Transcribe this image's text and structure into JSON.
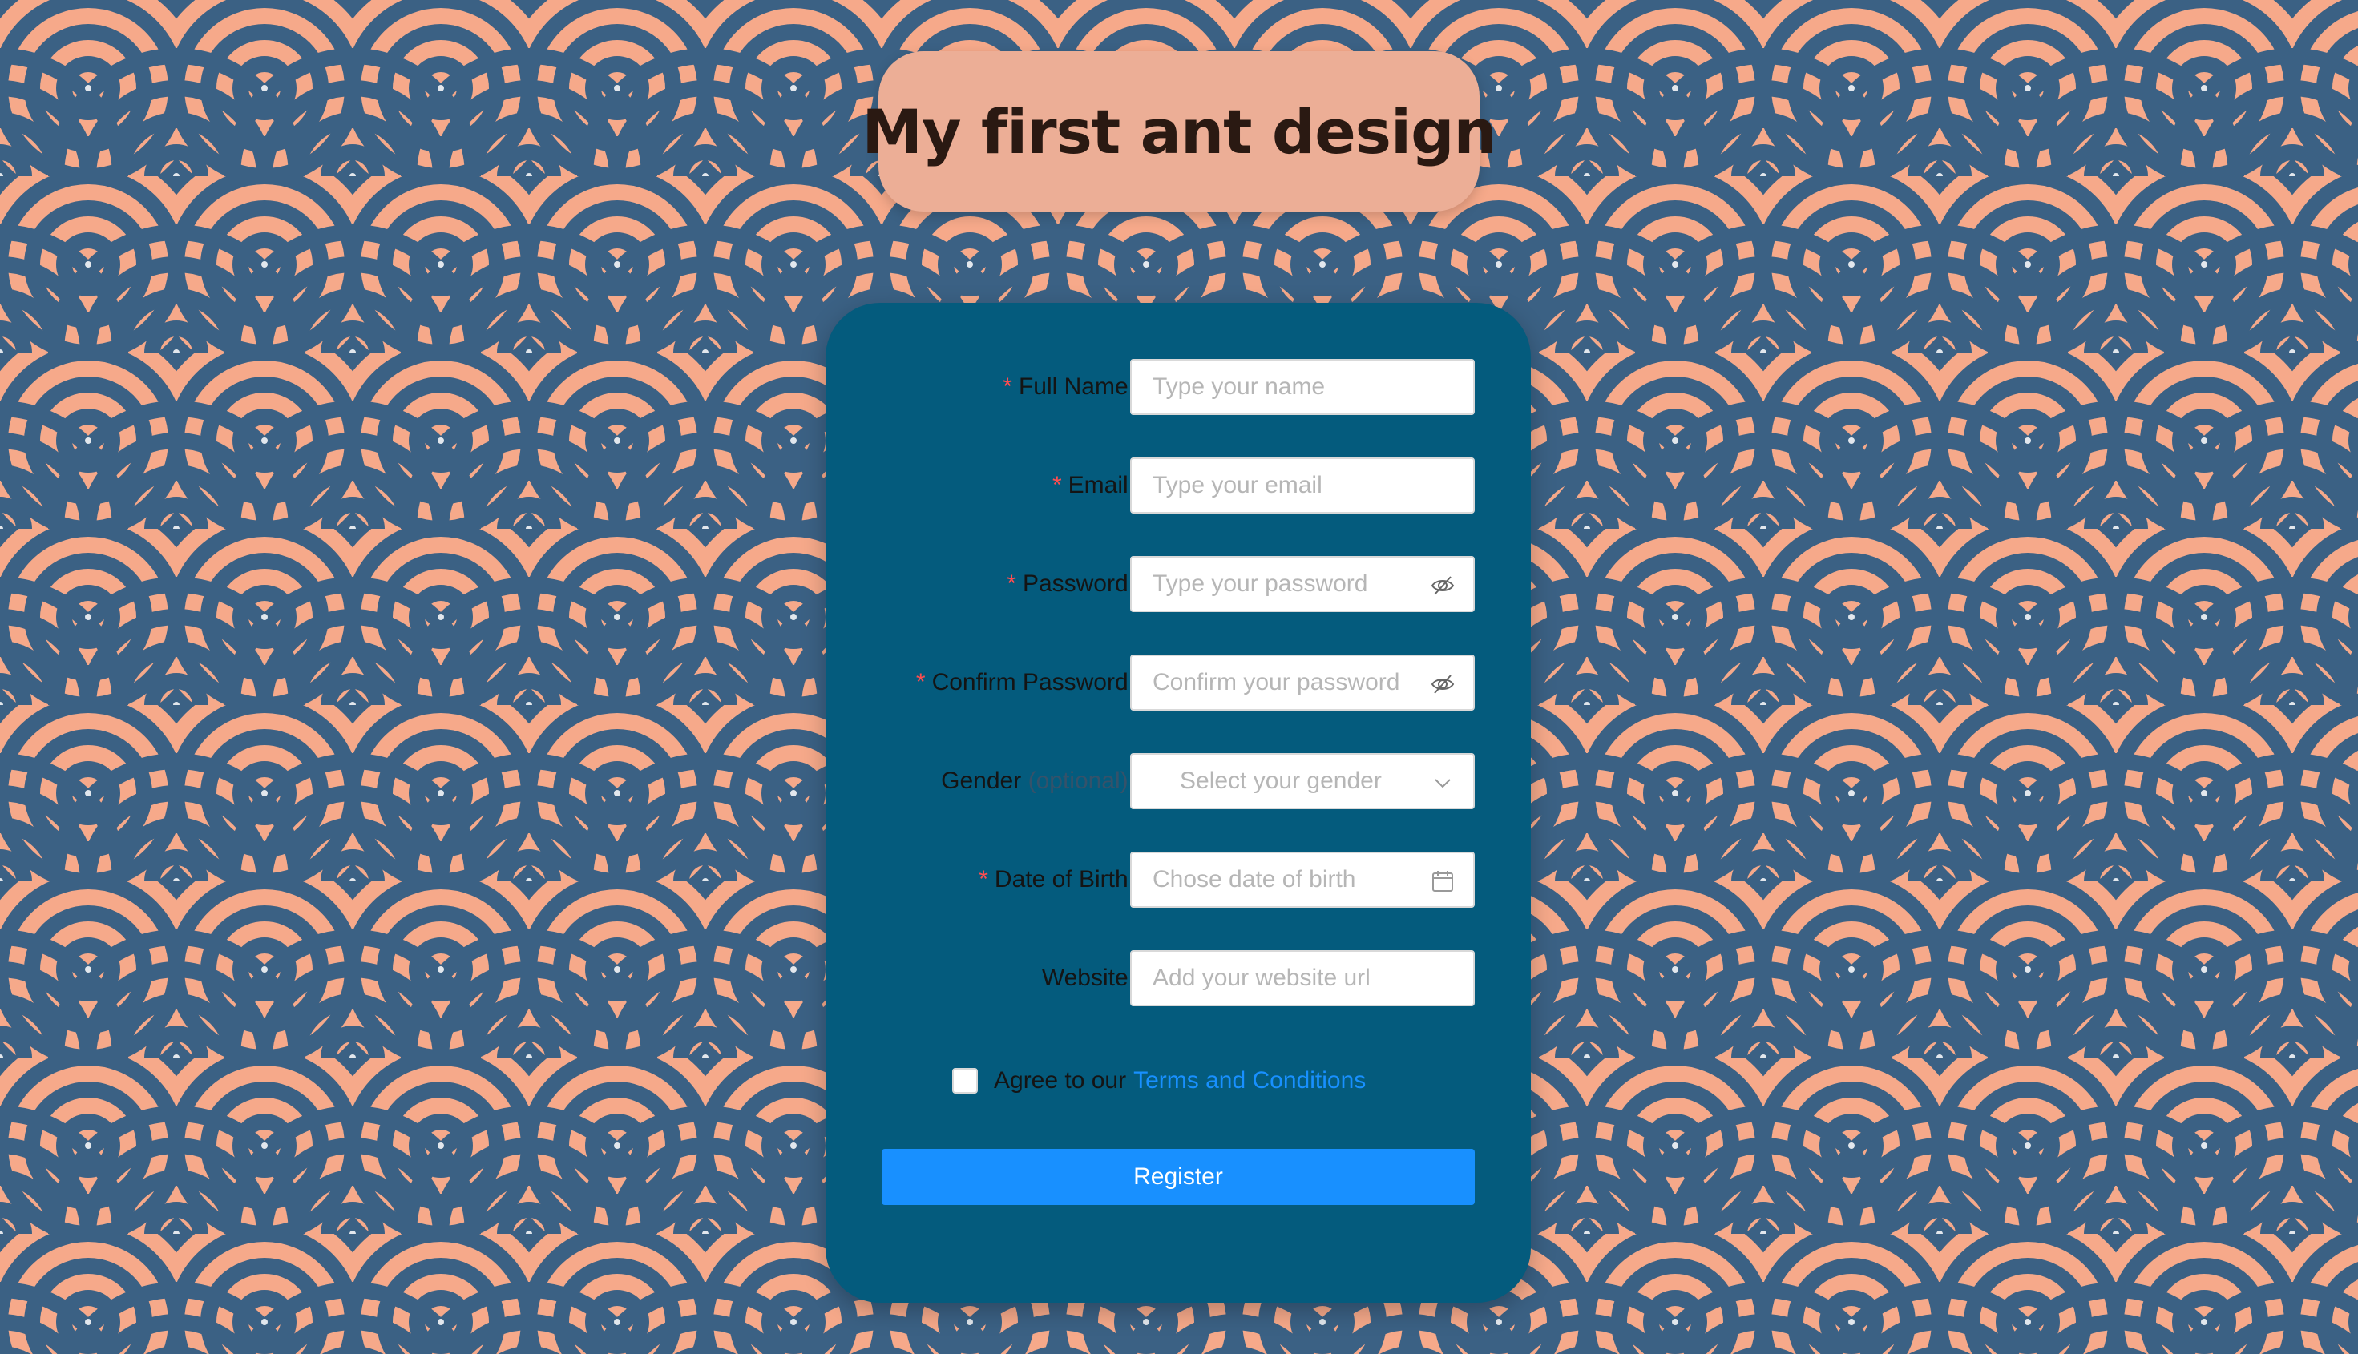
{
  "app_title": "My first ant design",
  "colors": {
    "background_pattern_light": "#f6a98a",
    "background_pattern_dark": "#3b6184",
    "title_box": "#ecae96",
    "card": "#045b7d",
    "primary": "#1890ff",
    "required_mark": "#ff4d4f"
  },
  "form": {
    "full_name": {
      "required_mark": "*",
      "label": "Full Name",
      "colon": ":",
      "placeholder": "Type your name"
    },
    "email": {
      "required_mark": "*",
      "label": "Email",
      "colon": ":",
      "placeholder": "Type your email"
    },
    "password": {
      "required_mark": "*",
      "label": "Password",
      "colon": ":",
      "placeholder": "Type your password",
      "icon": "eye-invisible-icon"
    },
    "confirm_password": {
      "required_mark": "*",
      "label": "Confirm Password",
      "colon": ":",
      "placeholder": "Confirm your password",
      "icon": "eye-invisible-icon"
    },
    "gender": {
      "label": "Gender",
      "optional": "(optional)",
      "colon": ":",
      "placeholder": "Select your gender",
      "icon": "chevron-down-icon"
    },
    "date_of_birth": {
      "required_mark": "*",
      "label": "Date of Birth",
      "colon": ":",
      "placeholder": "Chose date of birth",
      "icon": "calendar-icon"
    },
    "website": {
      "label": "Website",
      "colon": ":",
      "placeholder": "Add your website url"
    },
    "agreement": {
      "checked": false,
      "text": "Agree to our",
      "link_text": "Terms and Conditions"
    },
    "register_button": "Register"
  }
}
